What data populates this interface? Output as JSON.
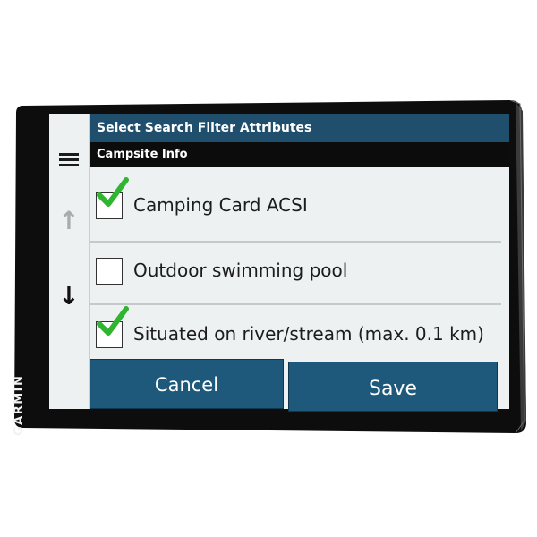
{
  "device": {
    "brand": "GARMIN"
  },
  "header": {
    "title": "Select Search Filter Attributes",
    "subtitle": "Campsite Info"
  },
  "sidebar": {
    "menu_icon": "menu-icon",
    "up_icon": "arrow-up-icon",
    "down_icon": "arrow-down-icon"
  },
  "options": [
    {
      "label": "Camping Card ACSI",
      "checked": true
    },
    {
      "label": "Outdoor swimming pool",
      "checked": false
    },
    {
      "label": "Situated on river/stream (max. 0.1 km)",
      "checked": true
    }
  ],
  "buttons": {
    "cancel": "Cancel",
    "save": "Save"
  },
  "colors": {
    "header_bg": "#1f4f6c",
    "subheader_bg": "#0c0c0c",
    "button_bg": "#1e587a",
    "check_green": "#2fb52f",
    "bezel": "#111111"
  }
}
